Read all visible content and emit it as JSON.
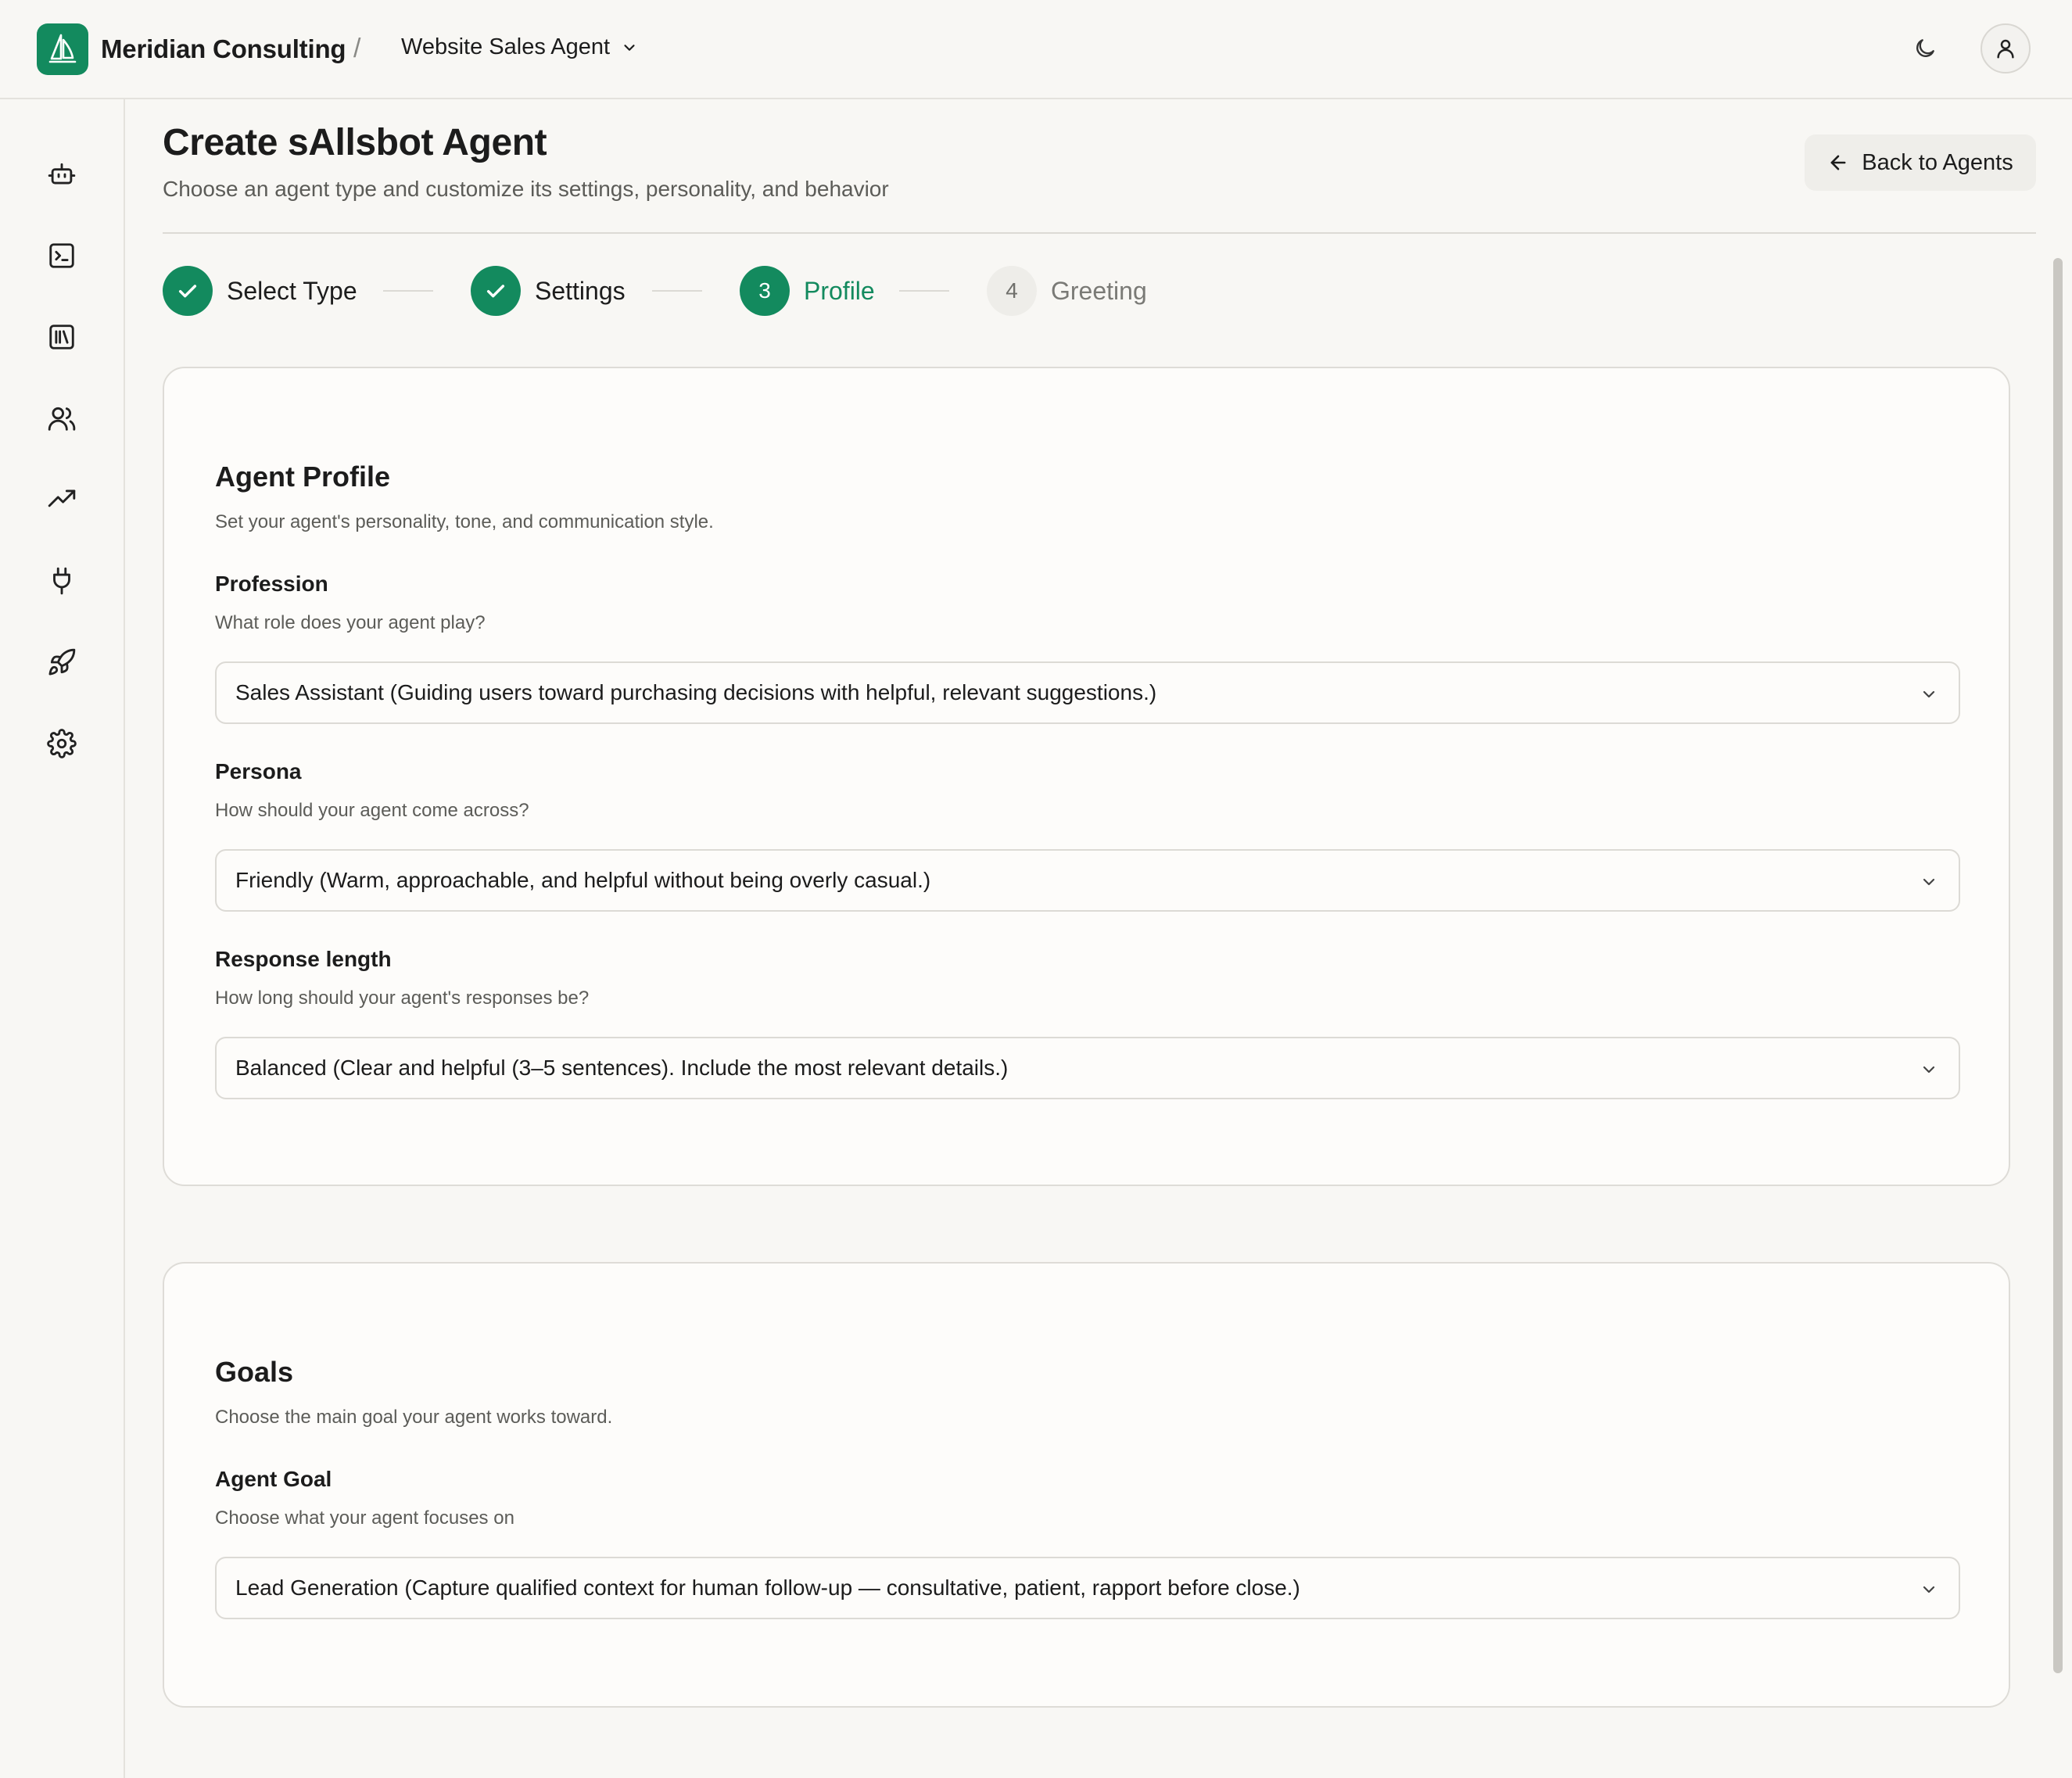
{
  "header": {
    "org_name": "Meridian Consulting",
    "separator": "/",
    "agent_name": "Website Sales Agent"
  },
  "icons": {
    "logo": "sail-logo-icon",
    "theme": "moon-icon",
    "account": "user-icon",
    "rail": [
      "bot-icon",
      "terminal-icon",
      "library-icon",
      "users-icon",
      "trending-up-icon",
      "plug-icon",
      "rocket-icon",
      "settings-icon"
    ]
  },
  "page": {
    "title": "Create sAllsbot Agent",
    "subtitle": "Choose an agent type and customize its settings, personality, and behavior",
    "back_label": "Back to Agents"
  },
  "steps": [
    {
      "number": "1",
      "label": "Select Type",
      "state": "done"
    },
    {
      "number": "2",
      "label": "Settings",
      "state": "done"
    },
    {
      "number": "3",
      "label": "Profile",
      "state": "current"
    },
    {
      "number": "4",
      "label": "Greeting",
      "state": "pending"
    }
  ],
  "profile_card": {
    "title": "Agent Profile",
    "description": "Set your agent's personality, tone, and communication style.",
    "profession": {
      "label": "Profession",
      "help": "What role does your agent play?",
      "value": "Sales Assistant (Guiding users toward purchasing decisions with helpful, relevant suggestions.)"
    },
    "persona": {
      "label": "Persona",
      "help": "How should your agent come across?",
      "value": "Friendly (Warm, approachable, and helpful without being overly casual.)"
    },
    "response_length": {
      "label": "Response length",
      "help": "How long should your agent's responses be?",
      "value": "Balanced (Clear and helpful (3–5 sentences). Include the most relevant details.)"
    }
  },
  "goals_card": {
    "title": "Goals",
    "description": "Choose the main goal your agent works toward.",
    "agent_goal": {
      "label": "Agent Goal",
      "help": "Choose what your agent focuses on",
      "value": "Lead Generation (Capture qualified context for human follow-up — consultative, patient, rapport before close.)"
    }
  },
  "colors": {
    "accent": "#138a5e",
    "background": "#f8f7f4",
    "card": "#fdfcfa",
    "border": "#dedcd7"
  }
}
